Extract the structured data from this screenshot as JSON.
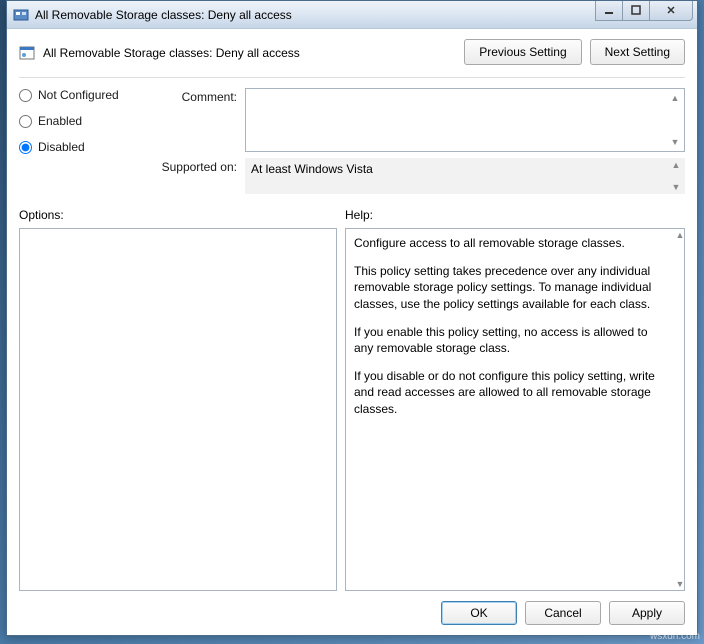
{
  "window": {
    "title": "All Removable Storage classes: Deny all access"
  },
  "header": {
    "policy_title": "All Removable Storage classes: Deny all access",
    "prev_btn": "Previous Setting",
    "next_btn": "Next Setting"
  },
  "state": {
    "not_configured": "Not Configured",
    "enabled": "Enabled",
    "disabled": "Disabled",
    "selected": "disabled"
  },
  "fields": {
    "comment_label": "Comment:",
    "comment_value": "",
    "supported_label": "Supported on:",
    "supported_value": "At least Windows Vista"
  },
  "panes": {
    "options_label": "Options:",
    "help_label": "Help:"
  },
  "help": {
    "p1": "Configure access to all removable storage classes.",
    "p2": "This policy setting takes precedence over any individual removable storage policy settings. To manage individual classes, use the policy settings available for each class.",
    "p3": "If you enable this policy setting, no access is allowed to any removable storage class.",
    "p4": "If you disable or do not configure this policy setting, write and read accesses are allowed to all removable storage classes."
  },
  "footer": {
    "ok": "OK",
    "cancel": "Cancel",
    "apply": "Apply"
  },
  "watermark": "wsxdn.com"
}
